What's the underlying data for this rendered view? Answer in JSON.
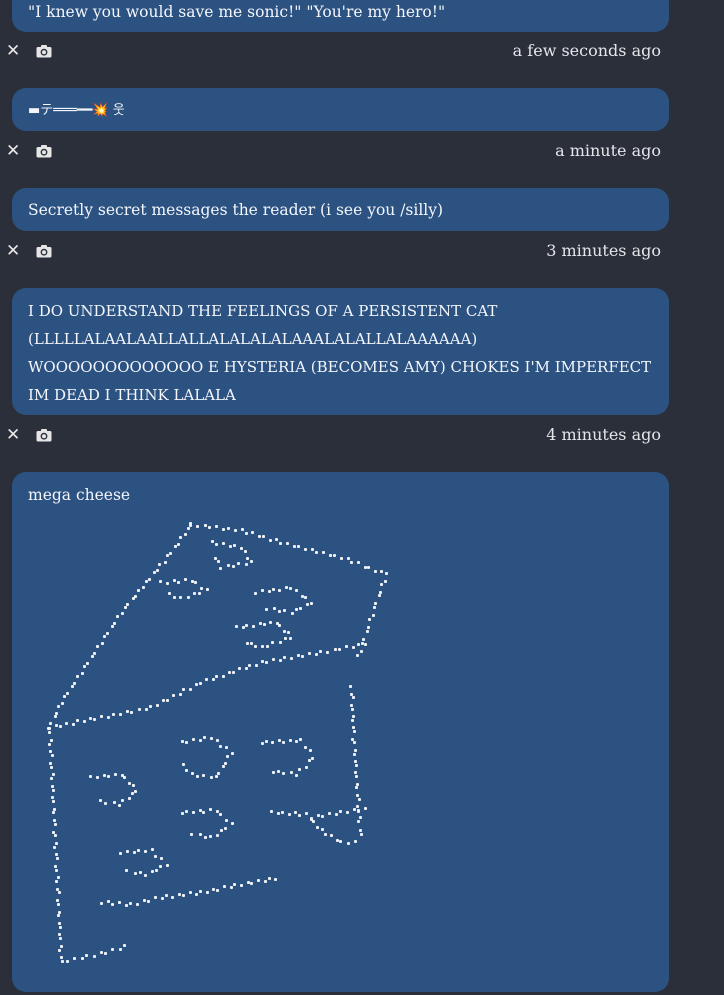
{
  "messages": [
    {
      "text": "\"I knew you would save me sonic!\" \"You're my hero!\"",
      "time": "a few seconds ago"
    },
    {
      "text": "▬テ═══━━💥 웃",
      "time": "a minute ago"
    },
    {
      "text": "Secretly secret messages the reader (i see you /silly)",
      "time": "3 minutes ago"
    },
    {
      "text": "I DO UNDERSTAND THE FEELINGS OF A PERSISTENT CAT (LLLLLALAALAALLALLALALALALAAALALALLALAAAAAA) WOOOOOOOOOOOOO E HYSTERIA (BECOMES AMY) CHOKES I'M IMPERFECT IM DEAD I THINK LALALA",
      "time": "4 minutes ago"
    },
    {
      "text": "mega cheese"
    }
  ],
  "icons": {
    "delete": "✕",
    "screenshot": "camera-icon"
  },
  "colors": {
    "background": "#2a2f3a",
    "bubble": "#2c5282",
    "text": "#f4f6fb"
  }
}
